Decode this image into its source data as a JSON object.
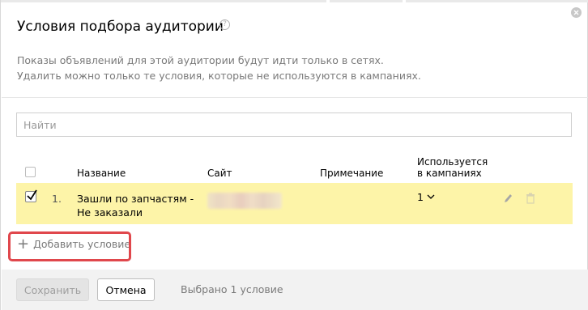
{
  "dialog": {
    "title": "Условия подбора аудитории",
    "help_icon": "?",
    "description_line1": "Показы объявлений для этой аудитории будут идти только в сетях.",
    "description_line2": "Удалить можно только те условия, которые не используются в кампаниях."
  },
  "search": {
    "placeholder": "Найти",
    "value": ""
  },
  "table": {
    "headers": {
      "name": "Название",
      "site": "Сайт",
      "note": "Примечание",
      "used_line1": "Используется",
      "used_line2": "в кампаниях"
    },
    "rows": [
      {
        "checked": true,
        "number": "1.",
        "name_line1": "Зашли по запчастям -",
        "name_line2": "Не заказали",
        "note": "",
        "usage": "1"
      }
    ]
  },
  "actions": {
    "add_condition": "Добавить условие"
  },
  "footer": {
    "save_label": "Сохранить",
    "cancel_label": "Отмена",
    "selected_text": "Выбрано 1 условие"
  },
  "colors": {
    "selected_row": "#fdf4a8",
    "highlight": "#e0474c",
    "footer_bg": "#f2f2f2"
  }
}
